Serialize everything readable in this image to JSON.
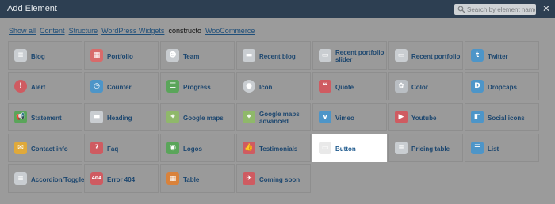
{
  "header": {
    "title": "Add Element",
    "search_placeholder": "Search by element name",
    "close": "✕"
  },
  "filters": [
    {
      "label": "Show all",
      "active": false
    },
    {
      "label": "Content",
      "active": false
    },
    {
      "label": "Structure",
      "active": false
    },
    {
      "label": "WordPress Widgets",
      "active": false
    },
    {
      "label": "constructo",
      "active": true
    },
    {
      "label": "WooCommerce",
      "active": false
    }
  ],
  "tiles": [
    {
      "label": "Blog",
      "icon": "blog-icon",
      "color": "#c9cdd1",
      "glyph": "≡",
      "round": false
    },
    {
      "label": "Portfolio",
      "icon": "portfolio-icon",
      "color": "#d86a6a",
      "glyph": "▦",
      "round": false
    },
    {
      "label": "Team",
      "icon": "team-icon",
      "color": "#c7cbcf",
      "glyph": "☻",
      "round": false
    },
    {
      "label": "Recent blog",
      "icon": "recent-blog-icon",
      "color": "#c9cdd1",
      "glyph": "▬",
      "round": false
    },
    {
      "label": "Recent portfolio slider",
      "icon": "recent-portfolio-slider-icon",
      "color": "#c9cdd1",
      "glyph": "▭",
      "round": false
    },
    {
      "label": "Recent portfolio",
      "icon": "recent-portfolio-icon",
      "color": "#c9cdd1",
      "glyph": "▭",
      "round": false
    },
    {
      "label": "Twitter",
      "icon": "twitter-icon",
      "color": "#4d95c8",
      "glyph": "t",
      "round": false
    },
    {
      "label": "Alert",
      "icon": "alert-icon",
      "color": "#cf5b61",
      "glyph": "!",
      "round": true
    },
    {
      "label": "Counter",
      "icon": "counter-icon",
      "color": "#4d95c8",
      "glyph": "◷",
      "round": false
    },
    {
      "label": "Progress",
      "icon": "progress-icon",
      "color": "#5aa55a",
      "glyph": "☰",
      "round": false
    },
    {
      "label": "Icon",
      "icon": "icon-element-icon",
      "color": "#c9cdd1",
      "glyph": "●",
      "round": true
    },
    {
      "label": "Quote",
      "icon": "quote-icon",
      "color": "#cf5b61",
      "glyph": "❝",
      "round": false
    },
    {
      "label": "Color",
      "icon": "color-icon",
      "color": "#b9bec3",
      "glyph": "✿",
      "round": false
    },
    {
      "label": "Dropcaps",
      "icon": "dropcaps-icon",
      "color": "#4d95c8",
      "glyph": "D",
      "round": false
    },
    {
      "label": "Statement",
      "icon": "statement-icon",
      "color": "#5aa55a",
      "glyph": "📢",
      "round": false
    },
    {
      "label": "Heading",
      "icon": "heading-icon",
      "color": "#c9cdd1",
      "glyph": "▬",
      "round": false
    },
    {
      "label": "Google maps",
      "icon": "google-maps-icon",
      "color": "#8fb86a",
      "glyph": "⌖",
      "round": false
    },
    {
      "label": "Google maps advanced",
      "icon": "google-maps-advanced-icon",
      "color": "#8fb86a",
      "glyph": "⌖",
      "round": false
    },
    {
      "label": "Vimeo",
      "icon": "vimeo-icon",
      "color": "#4d95c8",
      "glyph": "v",
      "round": false
    },
    {
      "label": "Youtube",
      "icon": "youtube-icon",
      "color": "#cf5b61",
      "glyph": "▶",
      "round": false
    },
    {
      "label": "Social icons",
      "icon": "social-icons-icon",
      "color": "#4d95c8",
      "glyph": "◧",
      "round": false
    },
    {
      "label": "Contact info",
      "icon": "contact-info-icon",
      "color": "#e0a93a",
      "glyph": "✉",
      "round": false
    },
    {
      "label": "Faq",
      "icon": "faq-icon",
      "color": "#cf5b61",
      "glyph": "?",
      "round": false
    },
    {
      "label": "Logos",
      "icon": "logos-icon",
      "color": "#5aa55a",
      "glyph": "◉",
      "round": false
    },
    {
      "label": "Testimonials",
      "icon": "testimonials-icon",
      "color": "#cf5b61",
      "glyph": "👍",
      "round": false
    },
    {
      "label": "Button",
      "icon": "button-icon",
      "color": "#e9e9e9",
      "glyph": "▭",
      "round": false,
      "highlight": true
    },
    {
      "label": "Pricing table",
      "icon": "pricing-table-icon",
      "color": "#c9cdd1",
      "glyph": "≡",
      "round": false
    },
    {
      "label": "List",
      "icon": "list-icon",
      "color": "#4d95c8",
      "glyph": "☰",
      "round": false
    },
    {
      "label": "Accordion/Toggle",
      "icon": "accordion-toggle-icon",
      "color": "#c9cdd1",
      "glyph": "≡",
      "round": false
    },
    {
      "label": "Error 404",
      "icon": "error-404-icon",
      "color": "#cf5b61",
      "glyph": "404",
      "round": false
    },
    {
      "label": "Table",
      "icon": "table-icon",
      "color": "#d9823b",
      "glyph": "▦",
      "round": false
    },
    {
      "label": "Coming soon",
      "icon": "coming-soon-icon",
      "color": "#cf5b61",
      "glyph": "✈",
      "round": false
    }
  ]
}
